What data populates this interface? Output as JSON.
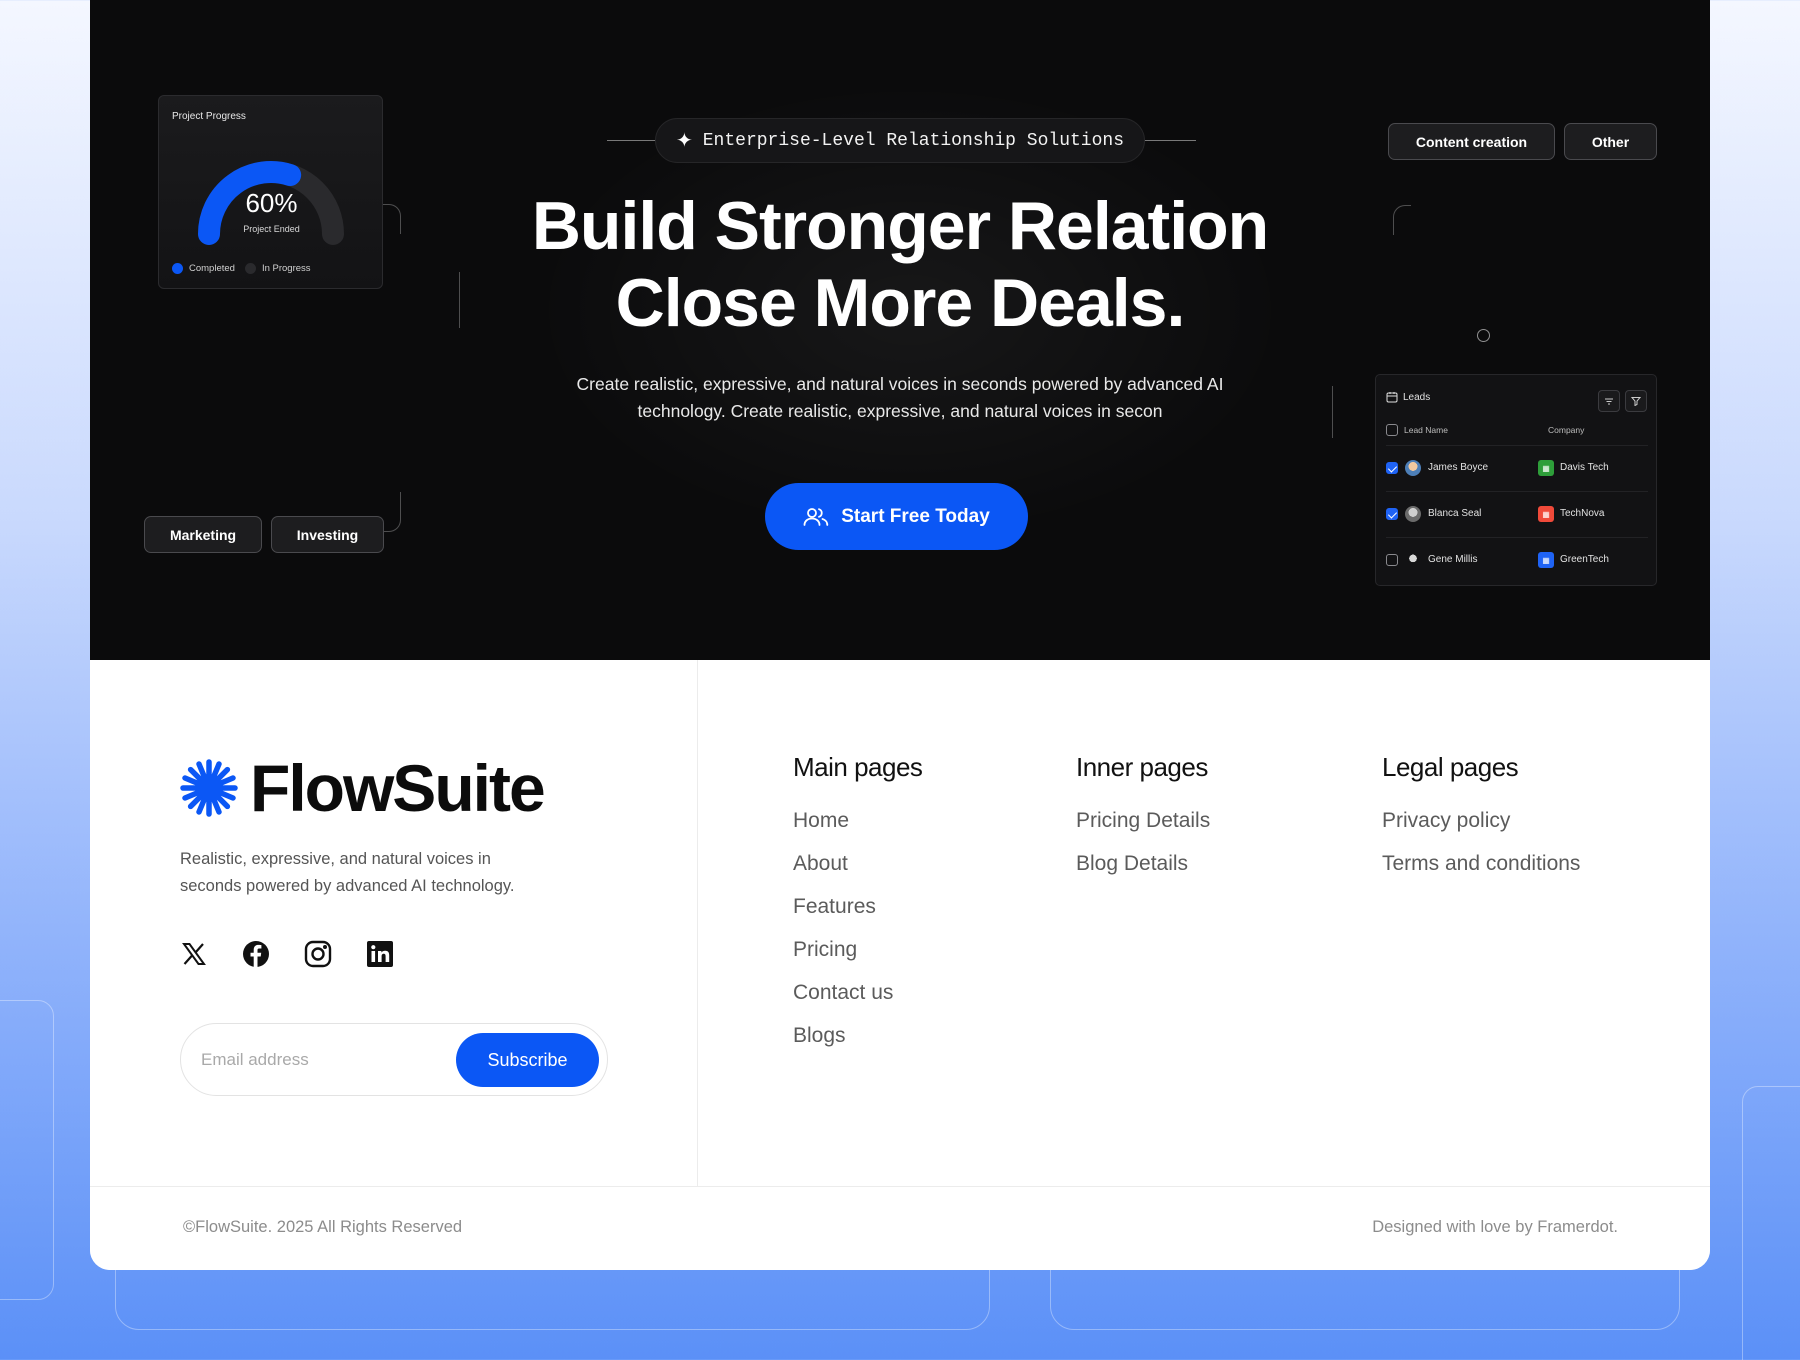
{
  "colors": {
    "accent": "#0b57f5",
    "hero_bg": "#0b0b0c",
    "text_dark": "#111111",
    "text_muted": "#5b5b5b"
  },
  "hero": {
    "eyebrow": "Enterprise-Level Relationship Solutions",
    "title_line1": "Build Stronger Relation",
    "title_line2": "Close More Deals.",
    "subtitle_line1": "Create realistic, expressive, and natural voices in seconds powered by advanced AI",
    "subtitle_line2": "technology. Create realistic, expressive, and natural voices in secon",
    "cta_label": "Start Free Today",
    "tags_left": [
      "Marketing",
      "Investing"
    ],
    "tags_right": [
      "Content creation",
      "Other"
    ]
  },
  "progress_card": {
    "title": "Project Progress",
    "value_label": "60%",
    "progress": 0.6,
    "sub_label": "Project Ended",
    "legend": [
      "Completed",
      "In Progress"
    ]
  },
  "leads": {
    "title": "Leads",
    "columns": [
      "Lead Name",
      "Company"
    ],
    "rows": [
      {
        "name": "James Boyce",
        "company": "Davis Tech",
        "checked": true,
        "logo_color": "#2e9e3a"
      },
      {
        "name": "Blanca Seal",
        "company": "TechNova",
        "checked": true,
        "logo_color": "#f04a3a"
      },
      {
        "name": "Gene Millis",
        "company": "GreenTech",
        "checked": false,
        "logo_color": "#1f63f5"
      }
    ]
  },
  "footer": {
    "brand": "FlowSuite",
    "description_line1": "Realistic, expressive, and natural voices in",
    "description_line2": "seconds powered by advanced AI technology.",
    "socials": [
      "x-icon",
      "facebook-icon",
      "instagram-icon",
      "linkedin-icon"
    ],
    "email_placeholder": "Email address",
    "subscribe_label": "Subscribe",
    "columns": [
      {
        "heading": "Main pages",
        "links": [
          "Home",
          "About",
          "Features",
          "Pricing",
          "Contact us",
          "Blogs"
        ]
      },
      {
        "heading": "Inner pages",
        "links": [
          "Pricing Details",
          "Blog Details"
        ]
      },
      {
        "heading": "Legal pages",
        "links": [
          "Privacy policy",
          "Terms and conditions"
        ]
      }
    ],
    "copyright": "©FlowSuite. 2025 All Rights Reserved",
    "credit": "Designed with love by Framerdot."
  }
}
